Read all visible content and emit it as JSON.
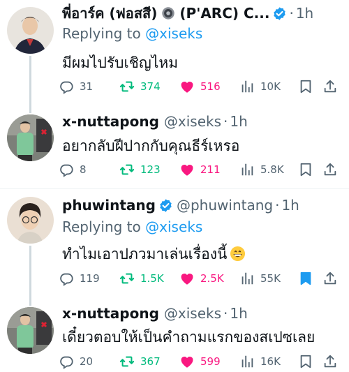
{
  "tweets": [
    {
      "name": "พี่อาร์ค (ฟอสสี) ⚙ (P'ARC) C...",
      "name_prefix": "พี่อาร์ค (ฟอสสี)",
      "name_suffix": "(P'ARC) C...",
      "verified": true,
      "handle": "",
      "time": "1h",
      "replying_label": "Replying to",
      "replying_to": "@xiseks",
      "text": "มีผมไปรับเชิญไหม",
      "replies": "31",
      "retweets": "374",
      "likes": "516",
      "views": "10K",
      "bookmarked": false
    },
    {
      "name": "x-nuttapong",
      "verified": false,
      "handle": "@xiseks",
      "time": "1h",
      "text": "อยากลับฝีปากกับคุณธีร์เหรอ",
      "replies": "8",
      "retweets": "123",
      "likes": "211",
      "views": "5.8K",
      "bookmarked": false
    },
    {
      "name": "phuwintang",
      "verified": true,
      "handle": "@phuwintang",
      "time": "1h",
      "replying_label": "Replying to",
      "replying_to": "@xiseks",
      "text": "ทำไมเอาปภวมาเล่นเรื่องนี้",
      "emoji": "grinning-face",
      "replies": "119",
      "retweets": "1.5K",
      "likes": "2.5K",
      "views": "55K",
      "bookmarked": true
    },
    {
      "name": "x-nuttapong",
      "verified": false,
      "handle": "@xiseks",
      "time": "1h",
      "text": "เดี๋ยวตอบให้เป็นคำถามแรกของสเปซเลย",
      "replies": "20",
      "retweets": "367",
      "likes": "599",
      "views": "16K",
      "bookmarked": false
    }
  ],
  "colors": {
    "accent": "#1d9bf0",
    "retweet": "#00ba7c",
    "like": "#f91880",
    "muted": "#536471",
    "text": "#0f1419"
  },
  "icons": [
    "reply-icon",
    "retweet-icon",
    "heart-icon",
    "views-icon",
    "bookmark-icon",
    "share-icon",
    "verified-badge-icon",
    "gear-icon"
  ]
}
